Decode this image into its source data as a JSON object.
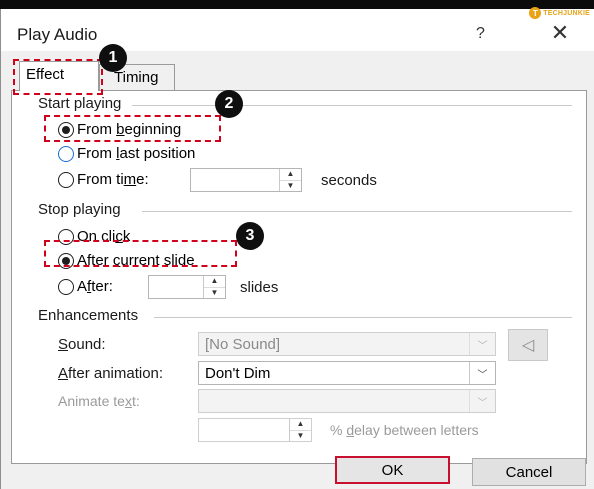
{
  "watermark": {
    "badge": "T",
    "text": "TECHJUNKIE"
  },
  "window": {
    "title": "Play Audio",
    "help": "?",
    "close": "✕"
  },
  "tabs": [
    {
      "label": "Effect",
      "active": true
    },
    {
      "label": "Timing",
      "active": false
    }
  ],
  "start_playing": {
    "label": "Start playing",
    "options": [
      {
        "pre": "From ",
        "u": "b",
        "post": "eginning",
        "checked": true
      },
      {
        "pre": "From ",
        "u": "l",
        "post": "ast position",
        "checked": false
      },
      {
        "pre": "From ti",
        "u": "m",
        "post": "e:",
        "checked": false
      }
    ],
    "seconds_value": "",
    "seconds_unit": "seconds"
  },
  "stop_playing": {
    "label": "Stop playing",
    "options": [
      {
        "pre": "On cli",
        "u": "c",
        "post": "k",
        "checked": false
      },
      {
        "pre": "After ",
        "u": "c",
        "post": "urrent slide",
        "checked": true
      },
      {
        "pre": "A",
        "u": "f",
        "post": "ter:",
        "checked": false
      }
    ],
    "slides_value": "",
    "slides_unit": "slides"
  },
  "enhancements": {
    "label": "Enhancements",
    "sound": {
      "pre": "",
      "u": "S",
      "post": "ound:",
      "value": "[No Sound]"
    },
    "after_animation": {
      "pre": "",
      "u": "A",
      "post": "fter animation:",
      "value": "Don't Dim"
    },
    "animate_text": {
      "pre": "Animate te",
      "u": "x",
      "post": "t:",
      "value": ""
    },
    "delay": {
      "value": "",
      "pre": "% ",
      "u": "d",
      "post": "elay between letters"
    }
  },
  "buttons": {
    "ok": "OK",
    "cancel": "Cancel"
  },
  "step_markers": [
    "1",
    "2",
    "3"
  ],
  "colors": {
    "highlight": "#d0021b",
    "marker": "#0f0f0f",
    "accent_radio": "#1a6fd6",
    "brand": "#e8a317"
  }
}
